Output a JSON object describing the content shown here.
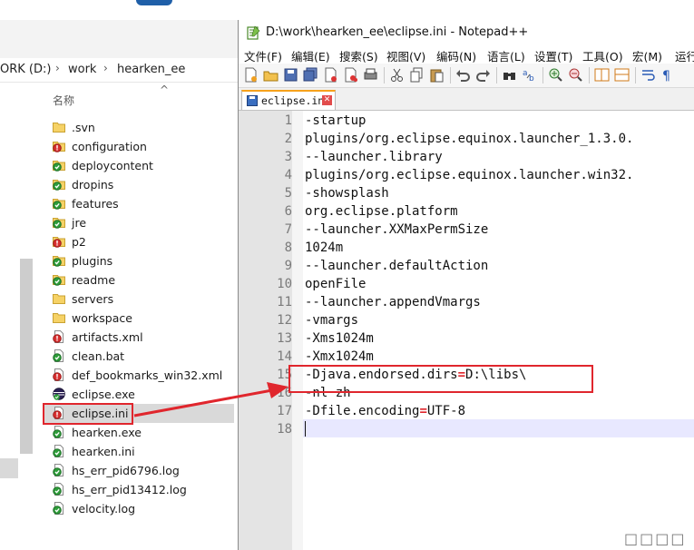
{
  "explorer": {
    "address": {
      "drive": "ORK (D:)",
      "folder1": "work",
      "folder2": "hearken_ee",
      "sep": "›"
    },
    "column_name": "名称",
    "files": [
      {
        "name": ".svn",
        "icon": "folder-icon"
      },
      {
        "name": "configuration",
        "icon": "folder-conflict-icon"
      },
      {
        "name": "deploycontent",
        "icon": "folder-ok-icon"
      },
      {
        "name": "dropins",
        "icon": "folder-ok-icon"
      },
      {
        "name": "features",
        "icon": "folder-ok-icon"
      },
      {
        "name": "jre",
        "icon": "folder-ok-icon"
      },
      {
        "name": "p2",
        "icon": "folder-conflict-icon"
      },
      {
        "name": "plugins",
        "icon": "folder-ok-icon"
      },
      {
        "name": "readme",
        "icon": "folder-ok-icon"
      },
      {
        "name": "servers",
        "icon": "folder-icon"
      },
      {
        "name": "workspace",
        "icon": "folder-icon"
      },
      {
        "name": "artifacts.xml",
        "icon": "file-conflict-icon"
      },
      {
        "name": "clean.bat",
        "icon": "file-ok-icon"
      },
      {
        "name": "def_bookmarks_win32.xml",
        "icon": "file-conflict-icon"
      },
      {
        "name": "eclipse.exe",
        "icon": "eclipse-icon"
      },
      {
        "name": "eclipse.ini",
        "icon": "file-conflict-icon"
      },
      {
        "name": "hearken.exe",
        "icon": "file-ok-icon"
      },
      {
        "name": "hearken.ini",
        "icon": "file-ok-icon"
      },
      {
        "name": "hs_err_pid6796.log",
        "icon": "file-ok-icon"
      },
      {
        "name": "hs_err_pid13412.log",
        "icon": "file-ok-icon"
      },
      {
        "name": "velocity.log",
        "icon": "file-ok-icon"
      }
    ],
    "selected_file": "eclipse.ini"
  },
  "npp": {
    "title": "D:\\work\\hearken_ee\\eclipse.ini - Notepad++",
    "menu": [
      "文件(F)",
      "编辑(E)",
      "搜索(S)",
      "视图(V)",
      "编码(N)",
      "语言(L)",
      "设置(T)",
      "工具(O)",
      "宏(M)",
      "运行"
    ],
    "tab_label": "eclipse.ini",
    "tab_close": "✕",
    "code_lines": [
      "-startup",
      "plugins/org.eclipse.equinox.launcher_1.3.0.",
      "--launcher.library",
      "plugins/org.eclipse.equinox.launcher.win32.",
      "-showsplash",
      "org.eclipse.platform",
      "--launcher.XXMaxPermSize",
      "1024m",
      "--launcher.defaultAction",
      "openFile",
      "--launcher.appendVmargs",
      "-vmargs",
      "-Xms1024m",
      "-Xmx1024m",
      "-Djava.endorsed.dirs=D:\\libs\\",
      "-nl zh",
      "-Dfile.encoding=UTF-8",
      ""
    ]
  },
  "colors": {
    "highlight": "#e0262d",
    "tab_accent": "#f7a21b",
    "current_line": "#e8e8ff"
  },
  "watermark": "□□□□"
}
